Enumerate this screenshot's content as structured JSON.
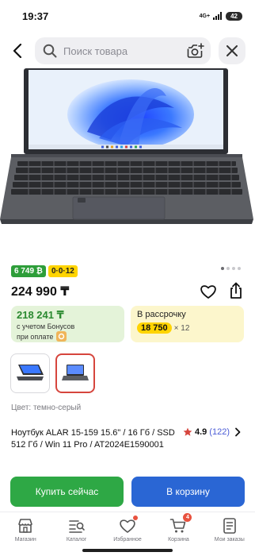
{
  "status_bar": {
    "time": "19:37",
    "network": "4G+",
    "battery": "42"
  },
  "search": {
    "placeholder": "Поиск товара",
    "icons": [
      "back-arrow-icon",
      "search-icon",
      "camera-icon",
      "close-icon"
    ]
  },
  "gallery": {
    "slide_count": 4,
    "active_index": 0
  },
  "badges": {
    "bonus": "6 749 ₿",
    "installment": "0·0·12"
  },
  "price": "224 990 ₸",
  "bonus_card": {
    "amount": "218 241 ₸",
    "line1": "с учетом Бонусов",
    "line2": "при оплате"
  },
  "installment_card": {
    "title": "В рассрочку",
    "monthly": "18 750",
    "months": "× 12"
  },
  "color_label": "Цвет: темно-серый",
  "product_title": "Ноутбук ALAR 15-159 15.6\" / 16 Гб / SSD 512 Гб / Win 11 Pro / AT2024E1590001",
  "rating": {
    "value": "4.9",
    "count": "(122)",
    "star_color": "#d6453d"
  },
  "actions": {
    "buy_now": "Купить сейчас",
    "add_to_cart": "В корзину"
  },
  "colors": {
    "green": "#2ea845",
    "blue": "#2a66d4",
    "accent_red": "#d6453d",
    "yellow": "#ffd400"
  },
  "nav": [
    {
      "label": "Магазин",
      "icon": "store-icon"
    },
    {
      "label": "Каталог",
      "icon": "catalog-icon"
    },
    {
      "label": "Избранное",
      "icon": "heart-icon"
    },
    {
      "label": "Корзина",
      "icon": "cart-icon",
      "badge": "4"
    },
    {
      "label": "Мои заказы",
      "icon": "orders-icon"
    }
  ]
}
